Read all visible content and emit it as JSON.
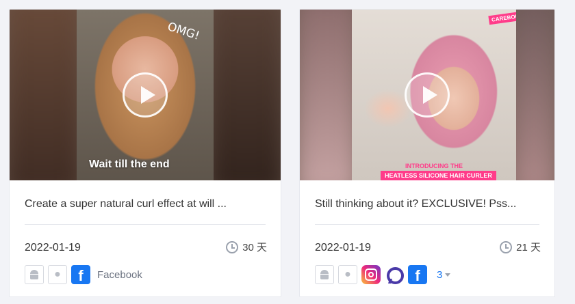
{
  "cards": [
    {
      "overlay_top": "OMG!",
      "overlay_caption": "Wait till the end",
      "title": "Create a super natural curl effect at will ...",
      "date": "2022-01-19",
      "duration": "30 天",
      "platform_label": "Facebook",
      "icons": [
        "android-icon",
        "apple-icon",
        "facebook-icon"
      ]
    },
    {
      "overlay_tag": "CAREBOU",
      "overlay_banner_1": "INTRODUCING THE",
      "overlay_banner_2": "HEATLESS SILICONE HAIR CURLER",
      "title": "Still thinking about it? EXCLUSIVE! Pss...",
      "date": "2022-01-19",
      "duration": "21 天",
      "more_count": "3",
      "icons": [
        "android-icon",
        "apple-icon",
        "instagram-icon",
        "audience-network-icon",
        "facebook-icon"
      ]
    }
  ],
  "colors": {
    "background": "#f2f3f7",
    "facebook": "#1877f2",
    "accent_pink": "#ff3c8a"
  }
}
